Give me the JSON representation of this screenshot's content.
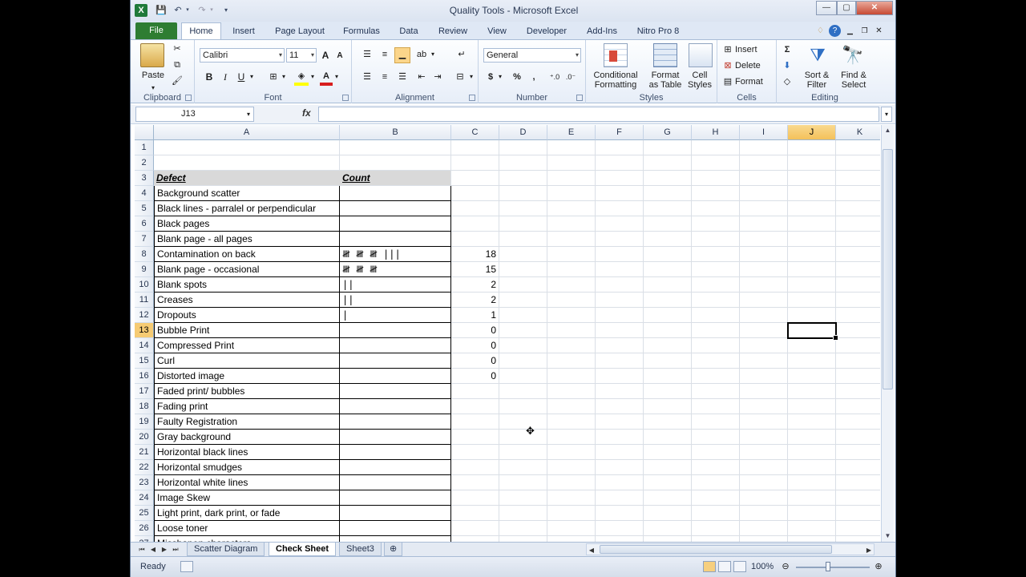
{
  "window": {
    "title": "Quality Tools - Microsoft Excel",
    "app_icon": "X",
    "quick_access": [
      "save-icon",
      "undo-icon",
      "redo-icon",
      "customize-icon"
    ]
  },
  "ribbon_tabs": [
    "File",
    "Home",
    "Insert",
    "Page Layout",
    "Formulas",
    "Data",
    "Review",
    "View",
    "Developer",
    "Add-Ins",
    "Nitro Pro 8"
  ],
  "active_tab": "Home",
  "ribbon": {
    "clipboard": {
      "label": "Clipboard",
      "paste": "Paste"
    },
    "font": {
      "label": "Font",
      "name": "Calibri",
      "size": "11",
      "bold": "B",
      "italic": "I",
      "underline": "U",
      "grow": "A",
      "shrink": "A"
    },
    "alignment": {
      "label": "Alignment"
    },
    "number": {
      "label": "Number",
      "format": "General",
      "currency": "$",
      "percent": "%",
      "comma": ","
    },
    "styles": {
      "label": "Styles",
      "conditional": "Conditional",
      "conditional2": "Formatting",
      "format_table": "Format",
      "format_table2": "as Table",
      "cell_styles": "Cell",
      "cell_styles2": "Styles"
    },
    "cells": {
      "label": "Cells",
      "insert": "Insert",
      "delete": "Delete",
      "format": "Format"
    },
    "editing": {
      "label": "Editing",
      "sort": "Sort &",
      "sort2": "Filter",
      "find": "Find &",
      "find2": "Select",
      "sigma": "Σ"
    }
  },
  "formula_bar": {
    "name_box": "J13",
    "fx": "fx",
    "content": ""
  },
  "columns": [
    "A",
    "B",
    "C",
    "D",
    "E",
    "F",
    "G",
    "H",
    "I",
    "J",
    "K"
  ],
  "selected_column": "J",
  "selected_row": 13,
  "rows": [
    {
      "n": 1,
      "a": "",
      "b": "",
      "c": ""
    },
    {
      "n": 2,
      "a": "",
      "b": "",
      "c": ""
    },
    {
      "n": 3,
      "a": "Defect",
      "b": "Count",
      "c": ""
    },
    {
      "n": 4,
      "a": "Background scatter",
      "b": "",
      "c": ""
    },
    {
      "n": 5,
      "a": "Black lines - parralel or perpendicular",
      "b": "",
      "c": ""
    },
    {
      "n": 6,
      "a": "Black pages",
      "b": "",
      "c": ""
    },
    {
      "n": 7,
      "a": "Blank page - all pages",
      "b": "",
      "c": ""
    },
    {
      "n": 8,
      "a": "Contamination on back",
      "b": "𝍸 𝍸 𝍸 |||",
      "c": "18"
    },
    {
      "n": 9,
      "a": "Blank page - occasional",
      "b": "𝍸 𝍸 𝍸",
      "c": "15"
    },
    {
      "n": 10,
      "a": "Blank spots",
      "b": "||",
      "c": "2"
    },
    {
      "n": 11,
      "a": "Creases",
      "b": "||",
      "c": "2"
    },
    {
      "n": 12,
      "a": "Dropouts",
      "b": "|",
      "c": "1"
    },
    {
      "n": 13,
      "a": "Bubble Print",
      "b": "",
      "c": "0"
    },
    {
      "n": 14,
      "a": "Compressed Print",
      "b": "",
      "c": "0"
    },
    {
      "n": 15,
      "a": "Curl",
      "b": "",
      "c": "0"
    },
    {
      "n": 16,
      "a": "Distorted image",
      "b": "",
      "c": "0"
    },
    {
      "n": 17,
      "a": "Faded print/ bubbles",
      "b": "",
      "c": ""
    },
    {
      "n": 18,
      "a": "Fading print",
      "b": "",
      "c": ""
    },
    {
      "n": 19,
      "a": "Faulty Registration",
      "b": "",
      "c": ""
    },
    {
      "n": 20,
      "a": "Gray background",
      "b": "",
      "c": ""
    },
    {
      "n": 21,
      "a": "Horizontal black lines",
      "b": "",
      "c": ""
    },
    {
      "n": 22,
      "a": "Horizontal smudges",
      "b": "",
      "c": ""
    },
    {
      "n": 23,
      "a": "Horizontal white lines",
      "b": "",
      "c": ""
    },
    {
      "n": 24,
      "a": "Image Skew",
      "b": "",
      "c": ""
    },
    {
      "n": 25,
      "a": "Light print, dark print, or fade",
      "b": "",
      "c": ""
    },
    {
      "n": 26,
      "a": "Loose toner",
      "b": "",
      "c": ""
    },
    {
      "n": 27,
      "a": "Misshapen characters",
      "b": "",
      "c": ""
    }
  ],
  "sheets": [
    "Scatter Diagram",
    "Check Sheet",
    "Sheet3"
  ],
  "active_sheet": "Check Sheet",
  "status": {
    "ready": "Ready",
    "zoom": "100%"
  }
}
